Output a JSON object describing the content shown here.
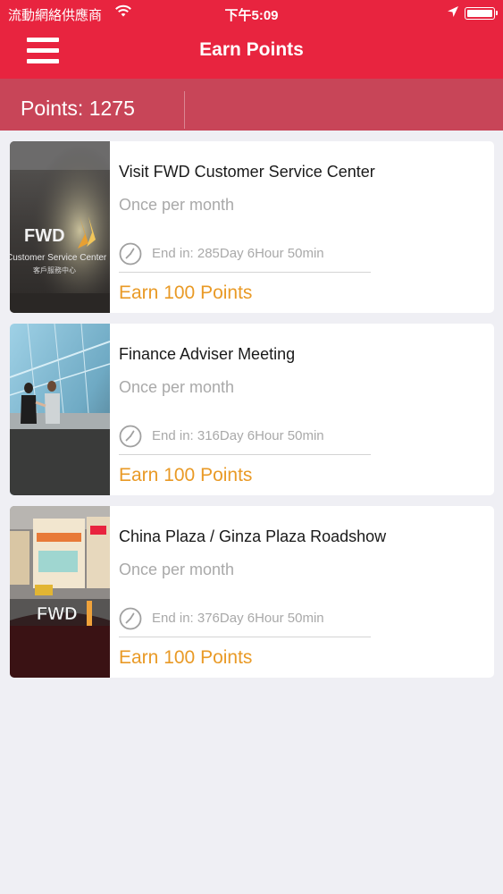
{
  "status_bar": {
    "carrier": "流動網絡供應商",
    "time": "下午5:09"
  },
  "header": {
    "title": "Earn Points"
  },
  "points": {
    "label": "Points: 1275"
  },
  "icons": {
    "menu": "menu-icon",
    "clock": "clock-icon",
    "wifi": "wifi-icon",
    "location": "location-arrow-icon",
    "battery": "battery-icon"
  },
  "colors": {
    "header": "#e8243f",
    "points_bar": "#c84558",
    "earn": "#e99a26",
    "background": "#efeff4"
  },
  "activities": [
    {
      "title": "Visit FWD Customer Service Center",
      "frequency": "Once per month",
      "end": "End in: 285Day 6Hour 50min",
      "earn": "Earn 100 Points",
      "photo_text": {
        "logo": "FWD",
        "sign": "Customer Service Center",
        "sign_cn": "客戶服務中心"
      }
    },
    {
      "title": "Finance Adviser Meeting",
      "frequency": "Once per month",
      "end": "End in: 316Day 6Hour 50min",
      "earn": "Earn 100 Points"
    },
    {
      "title": "China Plaza / Ginza Plaza Roadshow",
      "frequency": "Once per month",
      "end": "End in: 376Day 6Hour 50min",
      "earn": "Earn 100 Points",
      "photo_text": {
        "logo": "FWD"
      }
    }
  ]
}
